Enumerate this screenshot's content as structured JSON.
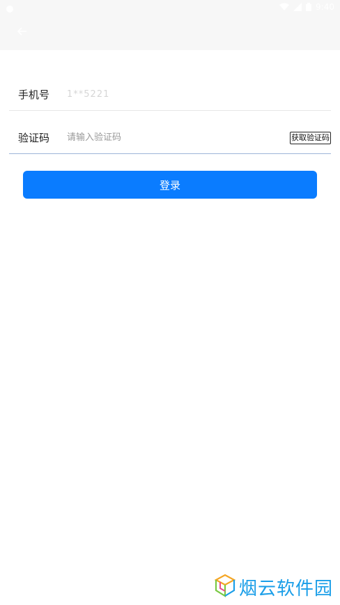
{
  "status_bar": {
    "time": "9:40"
  },
  "form": {
    "phone": {
      "label": "手机号",
      "value": "1**5221"
    },
    "code": {
      "label": "验证码",
      "placeholder": "请输入验证码",
      "button_label": "获取验证码"
    }
  },
  "login_button_label": "登录",
  "watermark": {
    "text": "烟云软件园"
  },
  "colors": {
    "primary": "#0a7cff",
    "header_bg": "#f7f7f7",
    "watermark": "#1a9ee8"
  }
}
